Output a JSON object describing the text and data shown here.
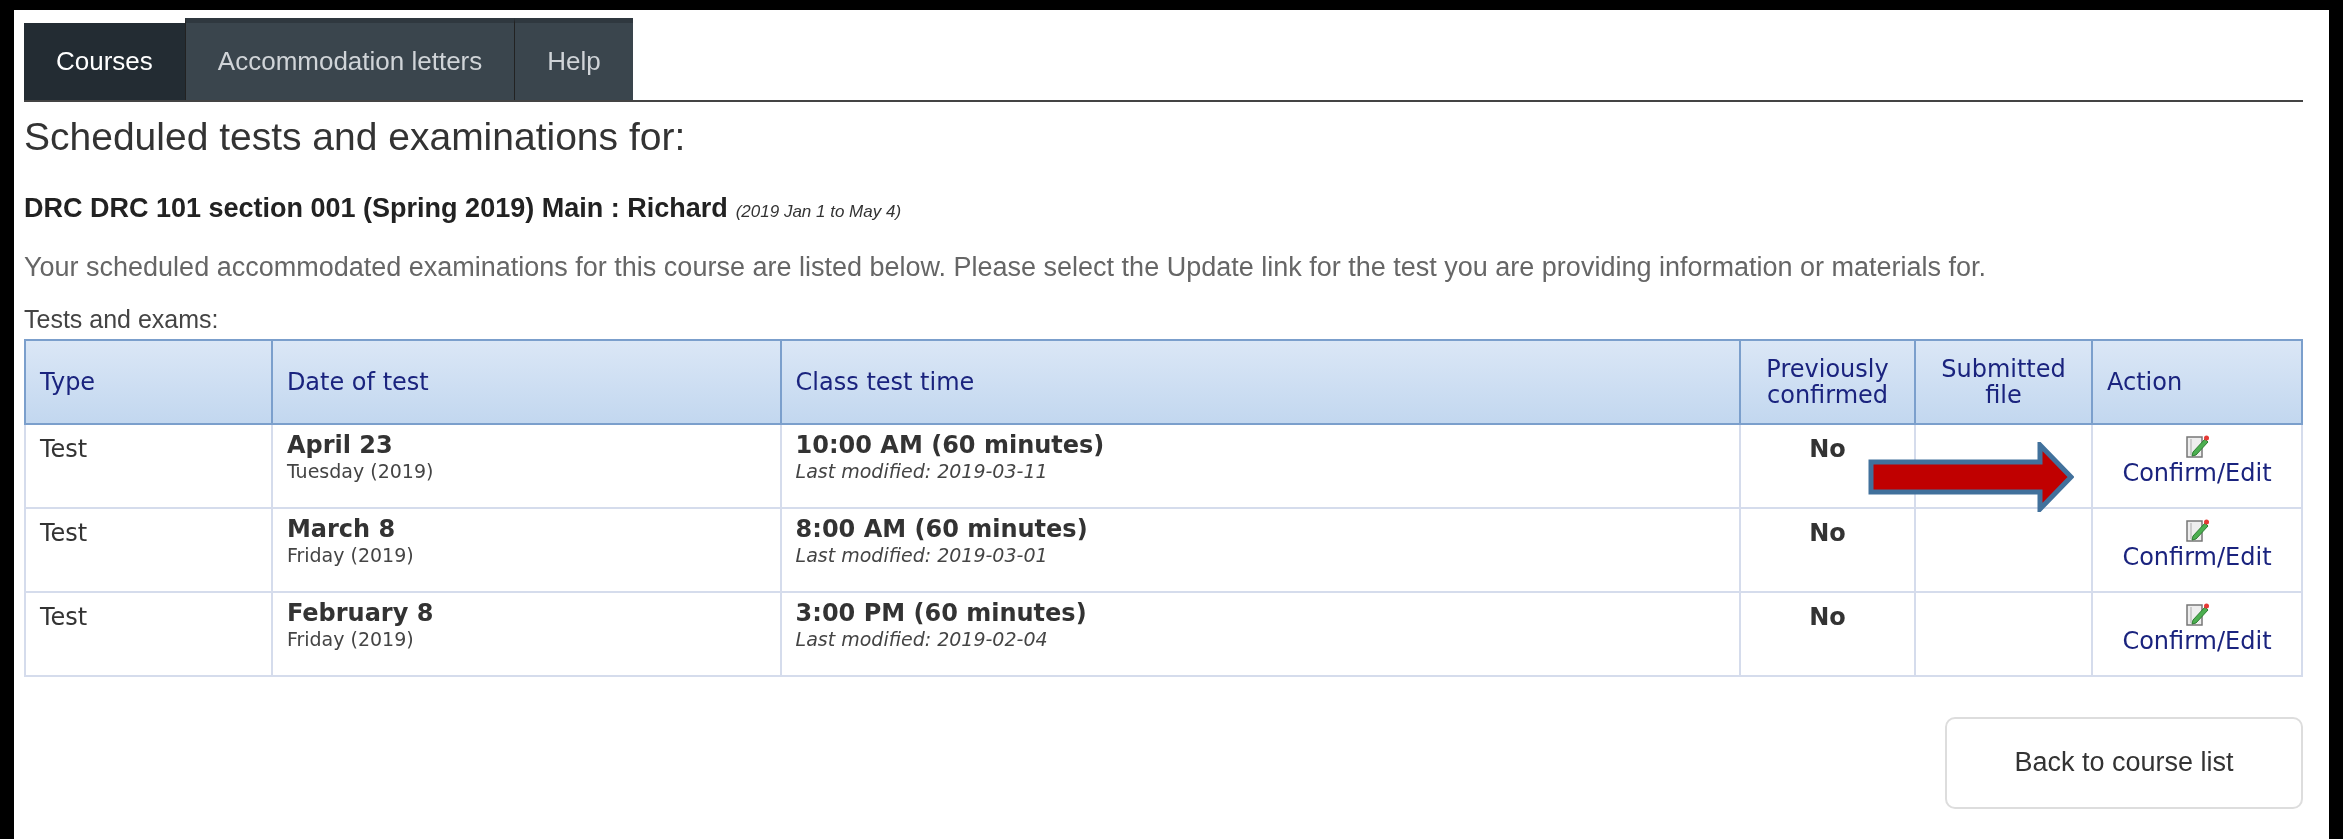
{
  "tabs": [
    {
      "label": "Courses",
      "selected": true
    },
    {
      "label": "Accommodation letters",
      "selected": false
    },
    {
      "label": "Help",
      "selected": false
    }
  ],
  "heading": "Scheduled tests and examinations for:",
  "course": {
    "name": "DRC DRC 101 section 001 (Spring 2019) Main : Richard",
    "dates": "(2019 Jan 1 to May 4)"
  },
  "intro": "Your scheduled accommodated examinations for this course are listed below. Please select the Update link for the test you are providing information or materials for.",
  "table_label": "Tests and exams:",
  "table": {
    "columns": [
      "Type",
      "Date of test",
      "Class test time",
      "Previously confirmed",
      "Submitted file",
      "Action"
    ],
    "rows": [
      {
        "type": "Test",
        "date": "April 23",
        "weekday": "Tuesday (2019)",
        "time": "10:00 AM (60 minutes)",
        "modified": "Last modified: 2019-03-11",
        "confirmed": "No",
        "action": "Confirm/Edit",
        "highlighted": true
      },
      {
        "type": "Test",
        "date": "March 8",
        "weekday": "Friday (2019)",
        "time": "8:00 AM (60 minutes)",
        "modified": "Last modified: 2019-03-01",
        "confirmed": "No",
        "action": "Confirm/Edit",
        "highlighted": false
      },
      {
        "type": "Test",
        "date": "February 8",
        "weekday": "Friday (2019)",
        "time": "3:00 PM (60 minutes)",
        "modified": "Last modified: 2019-02-04",
        "confirmed": "No",
        "action": "Confirm/Edit",
        "highlighted": false
      }
    ]
  },
  "back_button": "Back to course list"
}
